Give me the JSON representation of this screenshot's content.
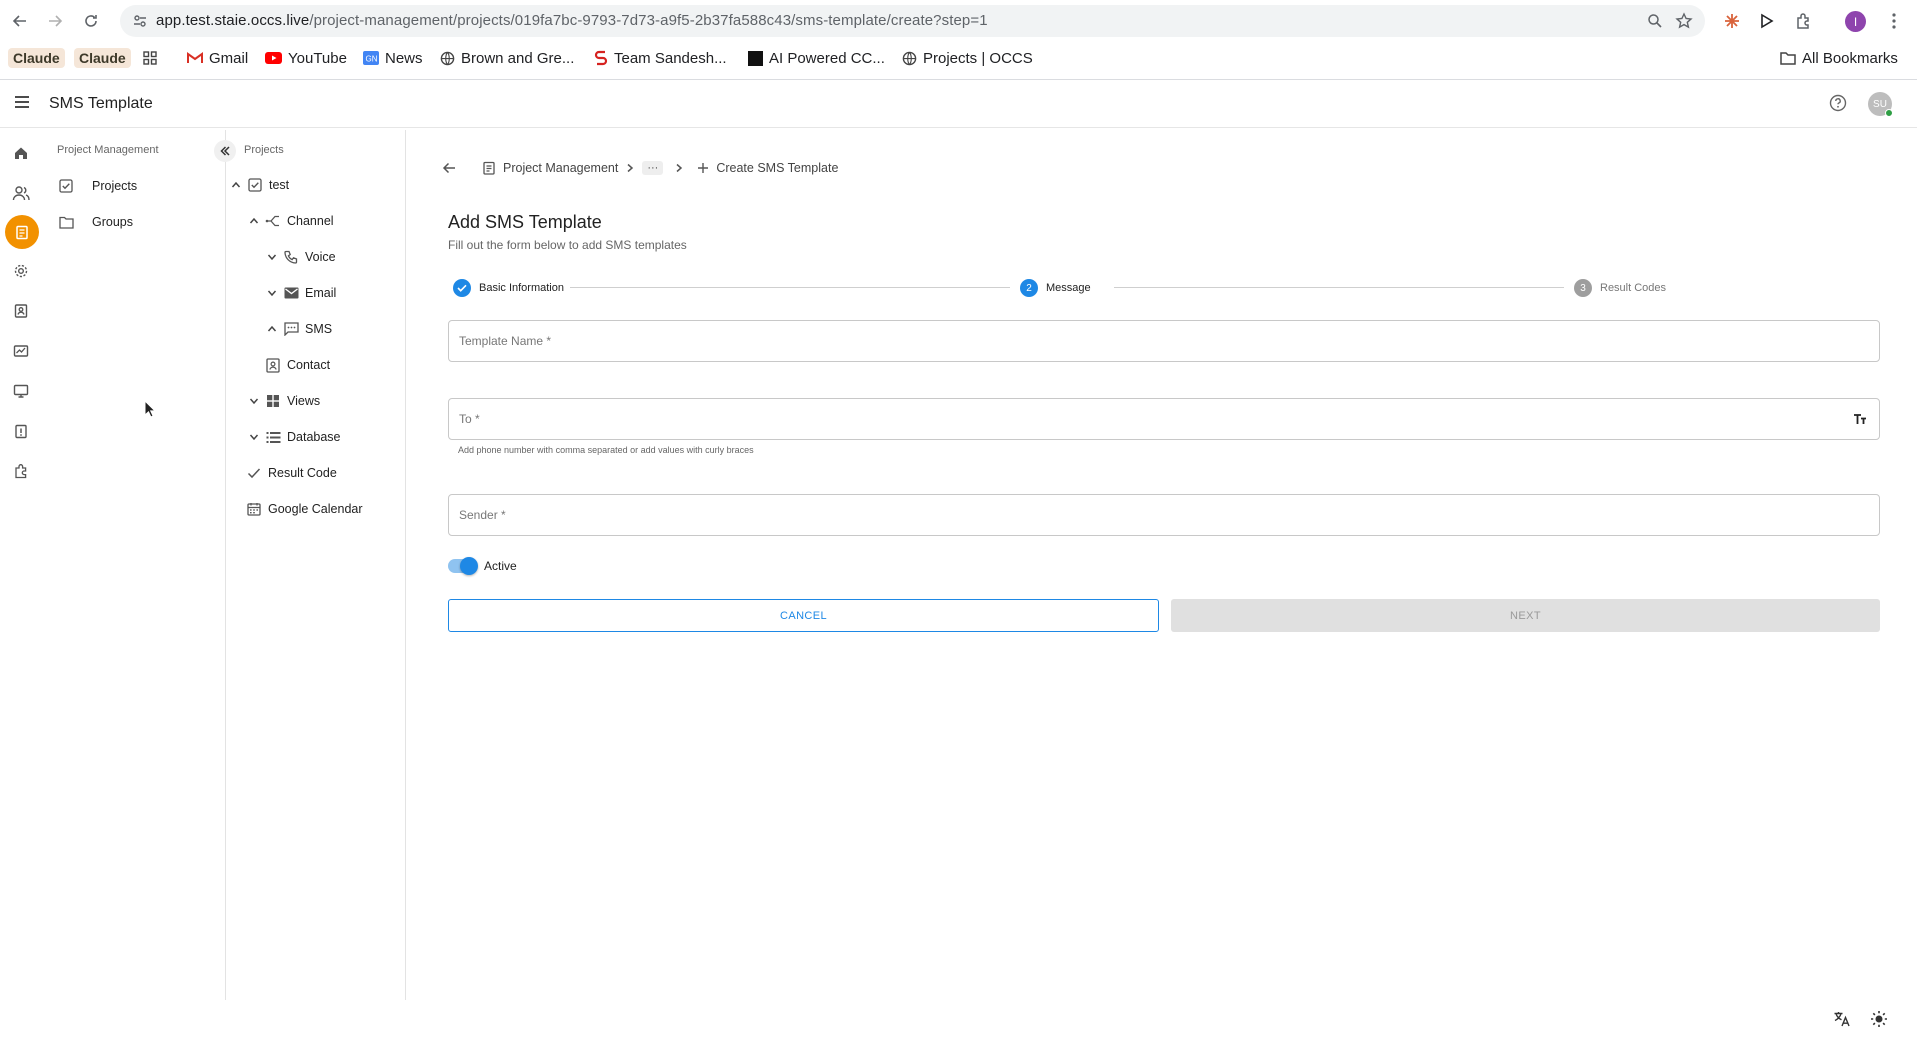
{
  "browser": {
    "url_host": "app.test.staie.occs.live",
    "url_path": "/project-management/projects/019fa7bc-9793-7d73-a9f5-2b37fa588c43/sms-template/create?step=1",
    "profile_initial": "I",
    "bookmarks": [
      {
        "label": "Claude",
        "icon": "claude-logo"
      },
      {
        "label": "Claude",
        "icon": "claude-logo"
      },
      {
        "label": "",
        "icon": "apps-grid-icon"
      },
      {
        "label": "Gmail",
        "icon": "gmail-icon"
      },
      {
        "label": "YouTube",
        "icon": "youtube-icon"
      },
      {
        "label": "News",
        "icon": "news-icon"
      },
      {
        "label": "Brown and Gre...",
        "icon": "globe-icon"
      },
      {
        "label": "Team Sandesh...",
        "icon": "sandesh-icon"
      },
      {
        "label": "AI Powered CC...",
        "icon": "ai-icon"
      },
      {
        "label": "Projects | OCCS",
        "icon": "globe-icon"
      }
    ],
    "all_bookmarks_label": "All Bookmarks"
  },
  "header": {
    "title": "SMS Template",
    "avatar_initials": "SU"
  },
  "panel1": {
    "header": "Project Management",
    "items": [
      {
        "label": "Projects",
        "icon": "checkbox-icon"
      },
      {
        "label": "Groups",
        "icon": "folder-icon"
      }
    ]
  },
  "panel2": {
    "header": "Projects",
    "tree": [
      {
        "label": "test",
        "icon": "checkbox-icon",
        "expanded": true
      },
      {
        "label": "Channel",
        "icon": "channel-icon",
        "expanded": true
      },
      {
        "label": "Voice",
        "icon": "phone-icon",
        "expanded": false
      },
      {
        "label": "Email",
        "icon": "mail-icon",
        "expanded": false
      },
      {
        "label": "SMS",
        "icon": "sms-icon",
        "expanded": true
      },
      {
        "label": "Contact",
        "icon": "contact-icon"
      },
      {
        "label": "Views",
        "icon": "grid-icon",
        "expanded": false
      },
      {
        "label": "Database",
        "icon": "list-icon",
        "expanded": false
      },
      {
        "label": "Result Code",
        "icon": "check-icon"
      },
      {
        "label": "Google Calendar",
        "icon": "calendar-icon"
      }
    ]
  },
  "breadcrumb": {
    "root": "Project Management",
    "ellipsis": "···",
    "current": "Create SMS Template"
  },
  "form": {
    "title": "Add SMS Template",
    "subtitle": "Fill out the form below to add SMS templates",
    "steps": [
      {
        "label": "Basic Information",
        "state": "done",
        "number": "1"
      },
      {
        "label": "Message",
        "state": "current",
        "number": "2"
      },
      {
        "label": "Result Codes",
        "state": "todo",
        "number": "3"
      }
    ],
    "template_name": {
      "placeholder": "Template Name *",
      "value": ""
    },
    "to": {
      "placeholder": "To *",
      "value": "",
      "helper": "Add phone number with comma separated or add values with curly braces"
    },
    "sender": {
      "placeholder": "Sender *",
      "value": ""
    },
    "active": {
      "label": "Active",
      "checked": true
    },
    "cancel_label": "CANCEL",
    "next_label": "NEXT"
  },
  "colors": {
    "accent": "#1e88e5",
    "rail_active": "#f29100",
    "online": "#2e9e44"
  }
}
